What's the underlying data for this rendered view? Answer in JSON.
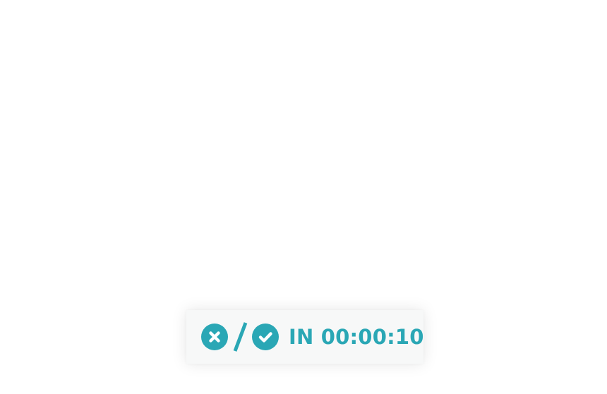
{
  "status_widget": {
    "reject_icon": "close-circle-icon",
    "separator": "/",
    "accept_icon": "check-circle-icon",
    "countdown_text": "IN 00:00:10"
  },
  "colors": {
    "accent": "#2aa7b5",
    "pill_background": "#f7f8f8",
    "page_background": "#ffffff"
  }
}
